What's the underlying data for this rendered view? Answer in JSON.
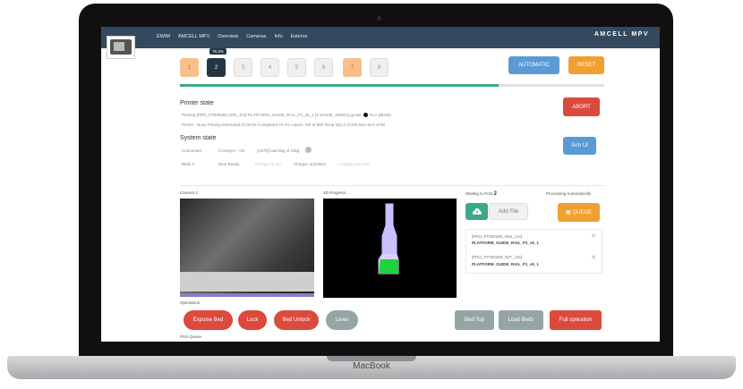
{
  "device": {
    "brand": "MacBook"
  },
  "header": {
    "title": "AMCELL MPV",
    "nav": [
      "EWIM",
      "AMCELL MPV",
      "Overview",
      "Cameras",
      "Info",
      "Exterior"
    ]
  },
  "steps": {
    "items": [
      "1",
      "2",
      "3",
      "4",
      "5",
      "6",
      "7",
      "8"
    ],
    "active_tooltip": "75.3%"
  },
  "buttons": {
    "automatic": "AUTOMATIC",
    "reset": "RESET",
    "abort": "ABORT",
    "arm_ui": "Arm UI",
    "add_file": "Add File",
    "queue": "QUEUE"
  },
  "progress": {
    "fraction": 0.75
  },
  "printer": {
    "heading": "Printer state",
    "file_line": "Printing [PRO_PT000389_N06_J13] PLATFORM_GUIDE_RAIL_P1_v5_1 [1 201108_183001].gcode",
    "material": "PLA (Black)",
    "status_line": "Printer - Busy Printing   Estimated 01:04:52   Completed 75.3%   Layers 755 of 800   Temp 202.3 of 205   Bed 49.8 of 60"
  },
  "system": {
    "heading": "System state",
    "row1": [
      "Connected",
      "Conveyor - OK",
      "[A279] load 9kg of 15kg"
    ],
    "row2": [
      "Beds 2",
      "Next Ready",
      "Charger at top",
      "Charger at bottom",
      "Loading next bed"
    ]
  },
  "sections": {
    "camera": "Camera 2",
    "progress3d": "3D Progress",
    "waiting_label": "Waiting to Print",
    "waiting_count": "2",
    "processing": "Processing Automatically",
    "operations": "Operations",
    "print_queue": "Print Queue"
  },
  "queue_files": [
    {
      "code": "[PRO_PT000389_N26_J14]",
      "name": "PLATFORM_GUIDE_RAIL_P1_v5_1"
    },
    {
      "code": "[PRO_PT000389_N27_J15]",
      "name": "PLATFORM_GUIDE_RAIL_P1_v5_1"
    }
  ],
  "operations": [
    "Expulse Bed",
    "Lock",
    "Bed Unlock",
    "Lever",
    "Bed Top",
    "Load Beds",
    "Full operation"
  ],
  "colors": {
    "nav_bg": "#34495e",
    "accent_blue": "#5b9bd5",
    "accent_orange": "#f0a030",
    "accent_red": "#dc4a3d",
    "accent_green": "#3aa889",
    "gray_btn": "#95a5a6"
  }
}
